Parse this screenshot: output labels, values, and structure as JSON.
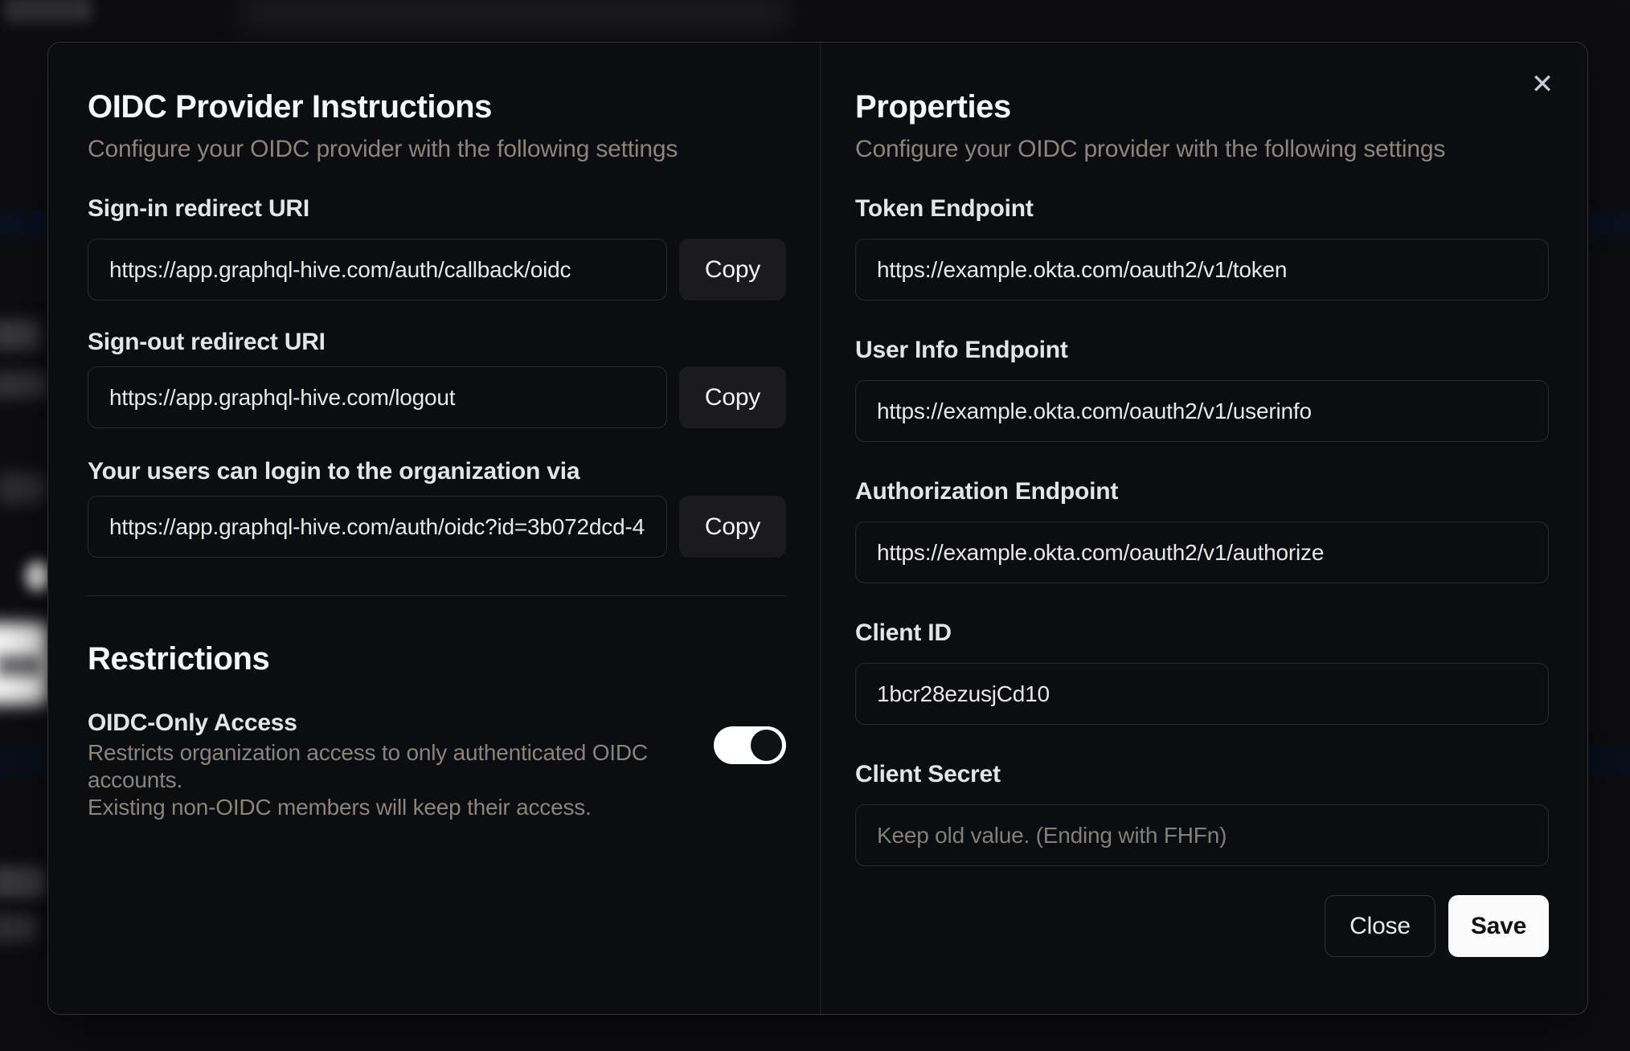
{
  "dialog": {
    "close_icon": "✕",
    "left": {
      "title": "OIDC Provider Instructions",
      "subtitle": "Configure your OIDC provider with the following settings",
      "fields": [
        {
          "label": "Sign-in redirect URI",
          "value": "https://app.graphql-hive.com/auth/callback/oidc",
          "button_label": "Copy"
        },
        {
          "label": "Sign-out redirect URI",
          "value": "https://app.graphql-hive.com/logout",
          "button_label": "Copy"
        },
        {
          "label": "Your users can login to the organization via",
          "value": "https://app.graphql-hive.com/auth/oidc?id=3b072dcd-4",
          "button_label": "Copy"
        }
      ],
      "restrictions": {
        "title": "Restrictions",
        "toggle_label": "OIDC-Only Access",
        "description_line1": "Restricts organization access to only authenticated OIDC accounts.",
        "description_line2": "Existing non-OIDC members will keep their access.",
        "toggle_state": "on"
      }
    },
    "right": {
      "title": "Properties",
      "subtitle": "Configure your OIDC provider with the following settings",
      "fields": [
        {
          "label": "Token Endpoint",
          "value": "https://example.okta.com/oauth2/v1/token"
        },
        {
          "label": "User Info Endpoint",
          "value": "https://example.okta.com/oauth2/v1/userinfo"
        },
        {
          "label": "Authorization Endpoint",
          "value": "https://example.okta.com/oauth2/v1/authorize"
        },
        {
          "label": "Client ID",
          "value": "1bcr28ezusjCd10"
        },
        {
          "label": "Client Secret",
          "value": "",
          "placeholder": "Keep old value. (Ending with FHFn)"
        }
      ],
      "footer": {
        "close_label": "Close",
        "save_label": "Save"
      }
    },
    "colors": {
      "modal_background": "#0c0d10",
      "save_button": "#fafafa",
      "toggle_on_track": "#ffffff",
      "toggle_knob": "#101114",
      "muted_text": "#8b857d"
    }
  }
}
